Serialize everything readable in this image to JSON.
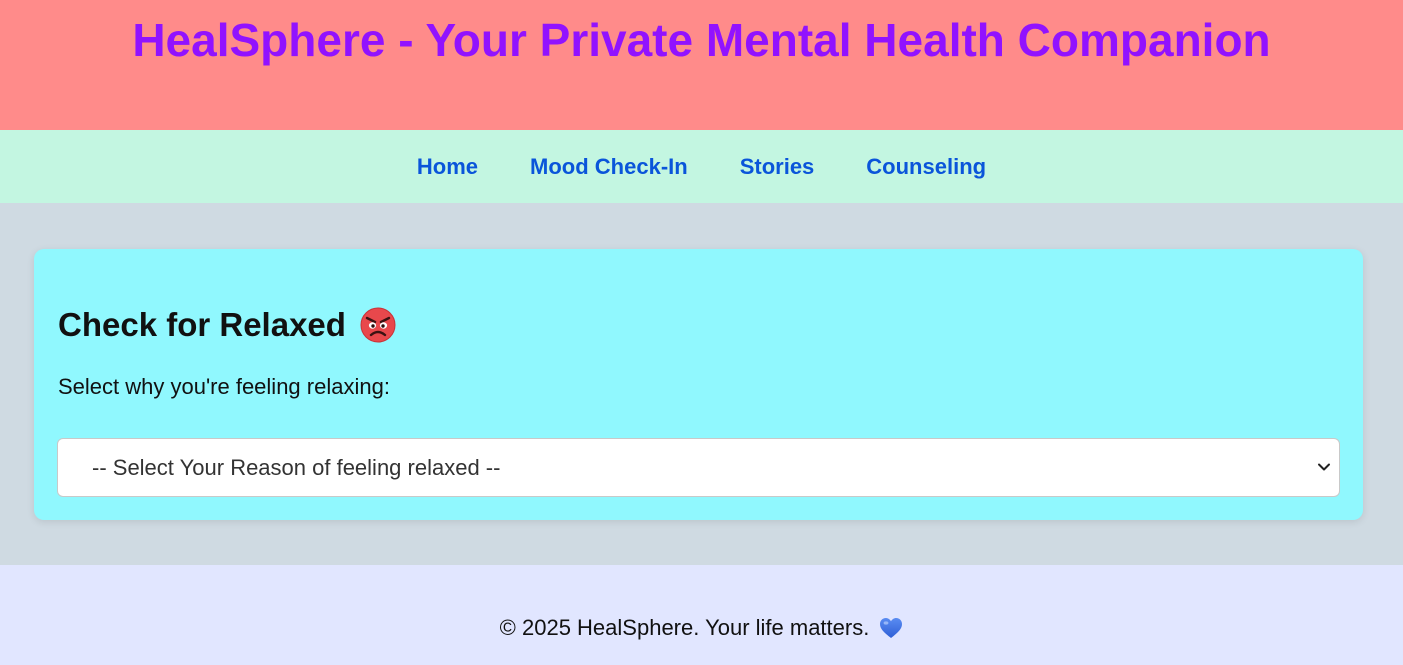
{
  "header": {
    "title": "HealSphere - Your Private Mental Health Companion"
  },
  "nav": {
    "items": [
      {
        "label": "Home"
      },
      {
        "label": "Mood Check-In"
      },
      {
        "label": "Stories"
      },
      {
        "label": "Counseling"
      }
    ]
  },
  "card": {
    "title": "Check for Relaxed",
    "title_icon": "angry-face-emoji",
    "prompt": "Select why you're feeling relaxing:",
    "select": {
      "selected": "-- Select Your Reason of feeling relaxed --"
    }
  },
  "footer": {
    "text": "© 2025 HealSphere. Your life matters.",
    "icon": "blue-heart-emoji"
  },
  "colors": {
    "header_bg": "#ff8b8a",
    "title": "#9112ff",
    "nav_bg": "#c3f6e1",
    "nav_link": "#0a55da",
    "page_bg": "#cfdae2",
    "card_bg": "#90f8fe",
    "footer_bg": "#e1e6ff"
  }
}
